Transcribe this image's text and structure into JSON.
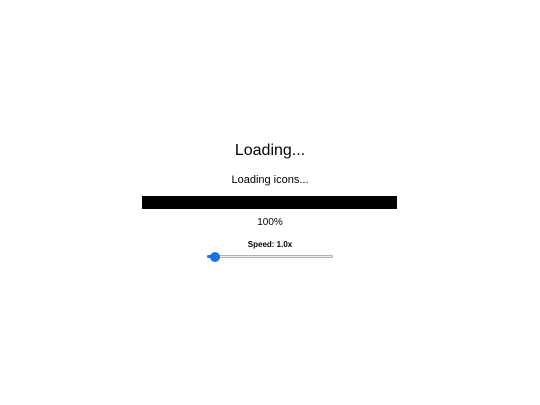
{
  "loader": {
    "title": "Loading...",
    "status": "Loading icons...",
    "progress": 1.0,
    "percent_text": "100%",
    "speed_label": "Speed: 1.0x",
    "speed_slider_fraction": 0.06
  },
  "colors": {
    "progress_fill": "#000000",
    "progress_track": "#e6e6e6",
    "slider_accent": "#1a73e8"
  }
}
